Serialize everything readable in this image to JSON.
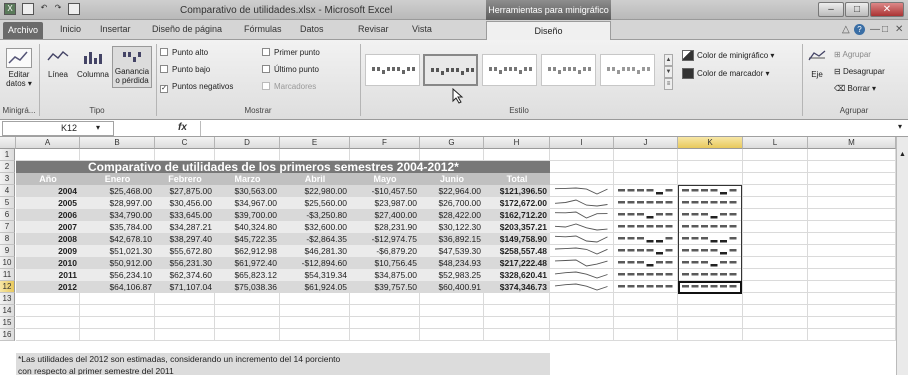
{
  "window": {
    "title": "Comparativo de utilidades.xlsx - Microsoft Excel",
    "contextual_group": "Herramientas para minigráfico",
    "buttons": [
      "–",
      "□",
      "✕"
    ]
  },
  "quick_access": [
    "X",
    "💾",
    "↶",
    "↷",
    "▦"
  ],
  "tabs": {
    "file": "Archivo",
    "items": [
      "Inicio",
      "Insertar",
      "Diseño de página",
      "Fórmulas",
      "Datos",
      "Revisar",
      "Vista"
    ],
    "active": "Diseño",
    "right_icons": [
      "△",
      "?",
      "—",
      "□",
      "✕"
    ]
  },
  "ribbon": {
    "edit": {
      "label": "Editar datos ▾",
      "group": "Minigrá..."
    },
    "tipo": {
      "group": "Tipo",
      "buttons": [
        "Línea",
        "Columna",
        "Ganancia o pérdida"
      ]
    },
    "mostrar": {
      "group": "Mostrar",
      "checks": [
        {
          "label": "Punto alto",
          "checked": false,
          "enabled": true
        },
        {
          "label": "Punto bajo",
          "checked": false,
          "enabled": true
        },
        {
          "label": "Puntos negativos",
          "checked": true,
          "enabled": true
        },
        {
          "label": "Primer punto",
          "checked": false,
          "enabled": true
        },
        {
          "label": "Último punto",
          "checked": false,
          "enabled": true
        },
        {
          "label": "Marcadores",
          "checked": false,
          "enabled": false
        }
      ]
    },
    "estilo": {
      "group": "Estilo",
      "tile_count": 5,
      "selected": 1
    },
    "color": {
      "sparkline": "Color de minigráfico ▾",
      "marker": "Color de marcador ▾"
    },
    "agrupar": {
      "group": "Agrupar",
      "axis": "Eje",
      "buttons": [
        "Agrupar",
        "Desagrupar",
        "Borrar ▾"
      ]
    }
  },
  "formula_bar": {
    "cell": "K12",
    "fx": "fx",
    "value": ""
  },
  "grid": {
    "columns": [
      "A",
      "B",
      "C",
      "D",
      "E",
      "F",
      "G",
      "H",
      "I",
      "J",
      "K",
      "L",
      "M"
    ],
    "rows": [
      "1",
      "2",
      "3",
      "4",
      "5",
      "6",
      "7",
      "8",
      "9",
      "10",
      "11",
      "12",
      "13",
      "14",
      "15",
      "16"
    ],
    "title": "Comparativo de utilidades de los primeros semestres 2004-2012*",
    "headers": [
      "Año",
      "Enero",
      "Febrero",
      "Marzo",
      "Abril",
      "Mayo",
      "Junio",
      "Total"
    ],
    "data": [
      [
        "2004",
        "$25,468.00",
        "$27,875.00",
        "$30,563.00",
        "$22,980.00",
        "-$10,457.50",
        "$22,964.00",
        "$121,396.50"
      ],
      [
        "2005",
        "$28,997.00",
        "$30,456.00",
        "$34,967.00",
        "$25,560.00",
        "$23,987.00",
        "$26,700.00",
        "$172,672.00"
      ],
      [
        "2006",
        "$34,790.00",
        "$33,645.00",
        "$39,700.00",
        "-$3,250.80",
        "$27,400.00",
        "$28,422.00",
        "$162,712.20"
      ],
      [
        "2007",
        "$35,784.00",
        "$34,287.21",
        "$40,324.80",
        "$32,600.00",
        "$28,231.90",
        "$30,122.30",
        "$203,357.21"
      ],
      [
        "2008",
        "$42,678.10",
        "$38,297.40",
        "$45,722.35",
        "-$2,864.35",
        "-$12,974.75",
        "$36,892.15",
        "$149,758.90"
      ],
      [
        "2009",
        "$51,021.30",
        "$55,672.80",
        "$62,912.98",
        "$46,281.30",
        "-$6,879.20",
        "$47,539.30",
        "$258,557.48"
      ],
      [
        "2010",
        "$50,912.00",
        "$56,231.30",
        "$61,972.40",
        "-$12,894.60",
        "$10,756.45",
        "$48,234.93",
        "$217,222.48"
      ],
      [
        "2011",
        "$56,234.10",
        "$62,374.60",
        "$65,823.12",
        "$54,319.34",
        "$34,875.00",
        "$52,983.25",
        "$328,620.41"
      ],
      [
        "2012",
        "$64,106.87",
        "$71,107.04",
        "$75,038.36",
        "$61,924.05",
        "$39,757.50",
        "$60,400.91",
        "$374,346.73"
      ]
    ],
    "notes": [
      "*Las utilidades del 2012 son estimadas, considerando un incremento del 14 porciento",
      "   con respecto al primer semestre del 2011"
    ]
  },
  "colors": {
    "banner": "#787878",
    "header_row": "#c0c0c0",
    "row_a": "#d9d9d9",
    "row_b": "#ebebeb"
  }
}
